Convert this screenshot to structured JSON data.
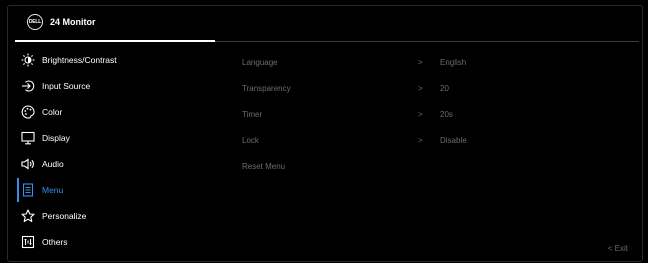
{
  "header": {
    "logo_text": "DELL",
    "title": "24 Monitor"
  },
  "menu": {
    "items": [
      {
        "label": "Brightness/Contrast",
        "icon": "brightness-icon"
      },
      {
        "label": "Input Source",
        "icon": "input-source-icon"
      },
      {
        "label": "Color",
        "icon": "color-palette-icon"
      },
      {
        "label": "Display",
        "icon": "display-icon"
      },
      {
        "label": "Audio",
        "icon": "speaker-icon"
      },
      {
        "label": "Menu",
        "icon": "menu-icon",
        "active": true
      },
      {
        "label": "Personalize",
        "icon": "star-icon"
      },
      {
        "label": "Others",
        "icon": "others-icon"
      }
    ]
  },
  "submenu": {
    "rows": [
      {
        "label": "Language",
        "value": "English",
        "chevron": ">"
      },
      {
        "label": "Transparency",
        "value": "20",
        "chevron": ">"
      },
      {
        "label": "Timer",
        "value": "20s",
        "chevron": ">"
      },
      {
        "label": "Lock",
        "value": "Disable",
        "chevron": ">"
      },
      {
        "label": "Reset Menu",
        "value": "",
        "chevron": ""
      }
    ]
  },
  "footer": {
    "exit_label": "< Exit"
  },
  "colors": {
    "accent": "#3a8ee8",
    "text": "#ffffff",
    "muted": "#6c6c6c",
    "background": "#000000"
  }
}
